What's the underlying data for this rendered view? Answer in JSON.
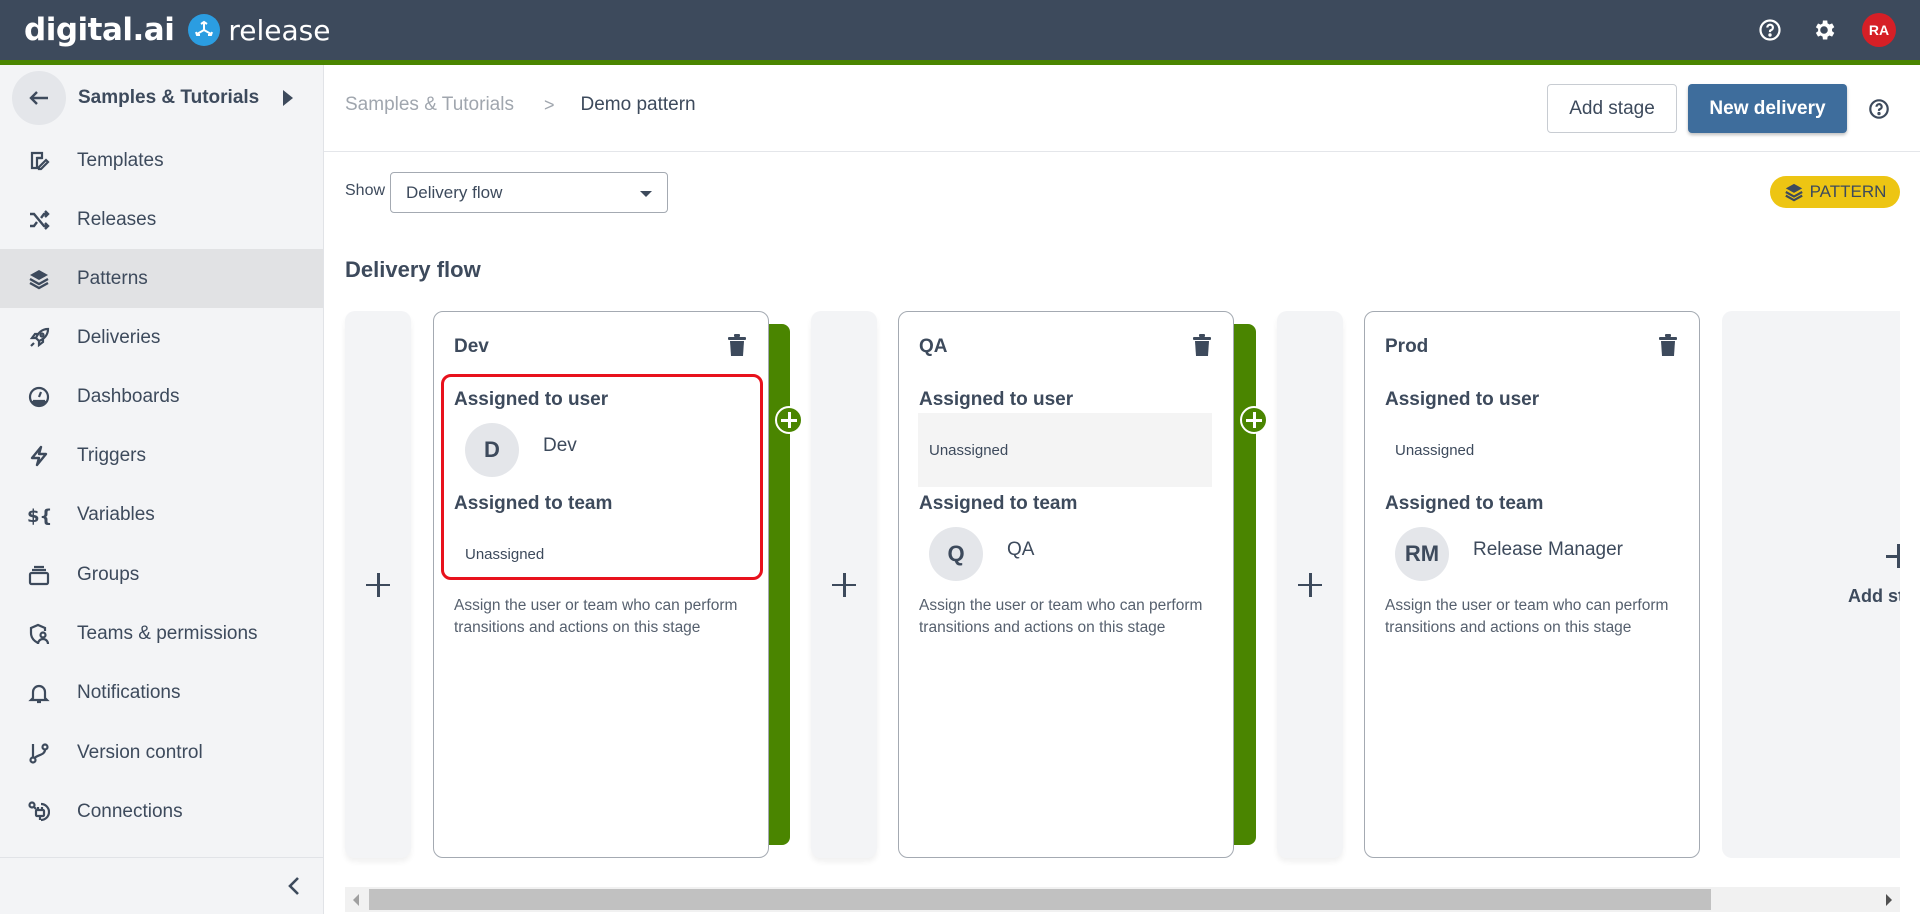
{
  "header": {
    "brand_left": "digital.ai",
    "brand_product": "release",
    "help_icon": "help-circle-icon",
    "settings_icon": "gear-icon",
    "user_initials": "RA",
    "colors": {
      "bar": "#3d4a5c",
      "accent": "#4a8500",
      "avatar": "#d61f26"
    }
  },
  "sidebar": {
    "back_icon": "arrow-left-icon",
    "folder_label": "Samples & Tutorials",
    "items": [
      {
        "label": "Templates",
        "icon": "template-icon",
        "active": false
      },
      {
        "label": "Releases",
        "icon": "shuffle-icon",
        "active": false
      },
      {
        "label": "Patterns",
        "icon": "layers-icon",
        "active": true
      },
      {
        "label": "Deliveries",
        "icon": "rocket-icon",
        "active": false
      },
      {
        "label": "Dashboards",
        "icon": "gauge-icon",
        "active": false
      },
      {
        "label": "Triggers",
        "icon": "lightning-icon",
        "active": false
      },
      {
        "label": "Variables",
        "icon": "variable-icon",
        "active": false
      },
      {
        "label": "Groups",
        "icon": "stack-icon",
        "active": false
      },
      {
        "label": "Teams & permissions",
        "icon": "shield-user-icon",
        "active": false
      },
      {
        "label": "Notifications",
        "icon": "bell-icon",
        "active": false
      },
      {
        "label": "Version control",
        "icon": "git-branch-icon",
        "active": false
      },
      {
        "label": "Connections",
        "icon": "plug-icon",
        "active": false
      }
    ],
    "collapse_icon": "chevron-left-icon"
  },
  "breadcrumb": {
    "parent": "Samples & Tutorials",
    "separator": ">",
    "current": "Demo pattern"
  },
  "toolbar": {
    "add_stage_label": "Add stage",
    "new_delivery_label": "New delivery",
    "help_icon": "help-circle-icon"
  },
  "filter": {
    "show_label": "Show",
    "selected": "Delivery flow"
  },
  "badge": {
    "label": "PATTERN",
    "color": "#edc513"
  },
  "section": {
    "title": "Delivery flow"
  },
  "stages": [
    {
      "name": "Dev",
      "user_label": "Assigned to user",
      "user": {
        "initials": "D",
        "name": "Dev"
      },
      "team_label": "Assigned to team",
      "team": {
        "unassigned": "Unassigned"
      },
      "description": "Assign the user or team who can perform transitions and actions on this stage"
    },
    {
      "name": "QA",
      "user_label": "Assigned to user",
      "user": {
        "unassigned": "Unassigned"
      },
      "team_label": "Assigned to team",
      "team": {
        "initials": "Q",
        "name": "QA"
      },
      "description": "Assign the user or team who can perform transitions and actions on this stage"
    },
    {
      "name": "Prod",
      "user_label": "Assigned to user",
      "user": {
        "unassigned": "Unassigned"
      },
      "team_label": "Assigned to team",
      "team": {
        "initials": "RM",
        "name": "Release Manager"
      },
      "description": "Assign the user or team who can perform transitions and actions on this stage"
    }
  ],
  "add_stage_column": {
    "label": "Add stage"
  },
  "colors": {
    "transition": "#4a8500",
    "highlight": "#e8111c",
    "primary_button": "#3e6d9c"
  }
}
